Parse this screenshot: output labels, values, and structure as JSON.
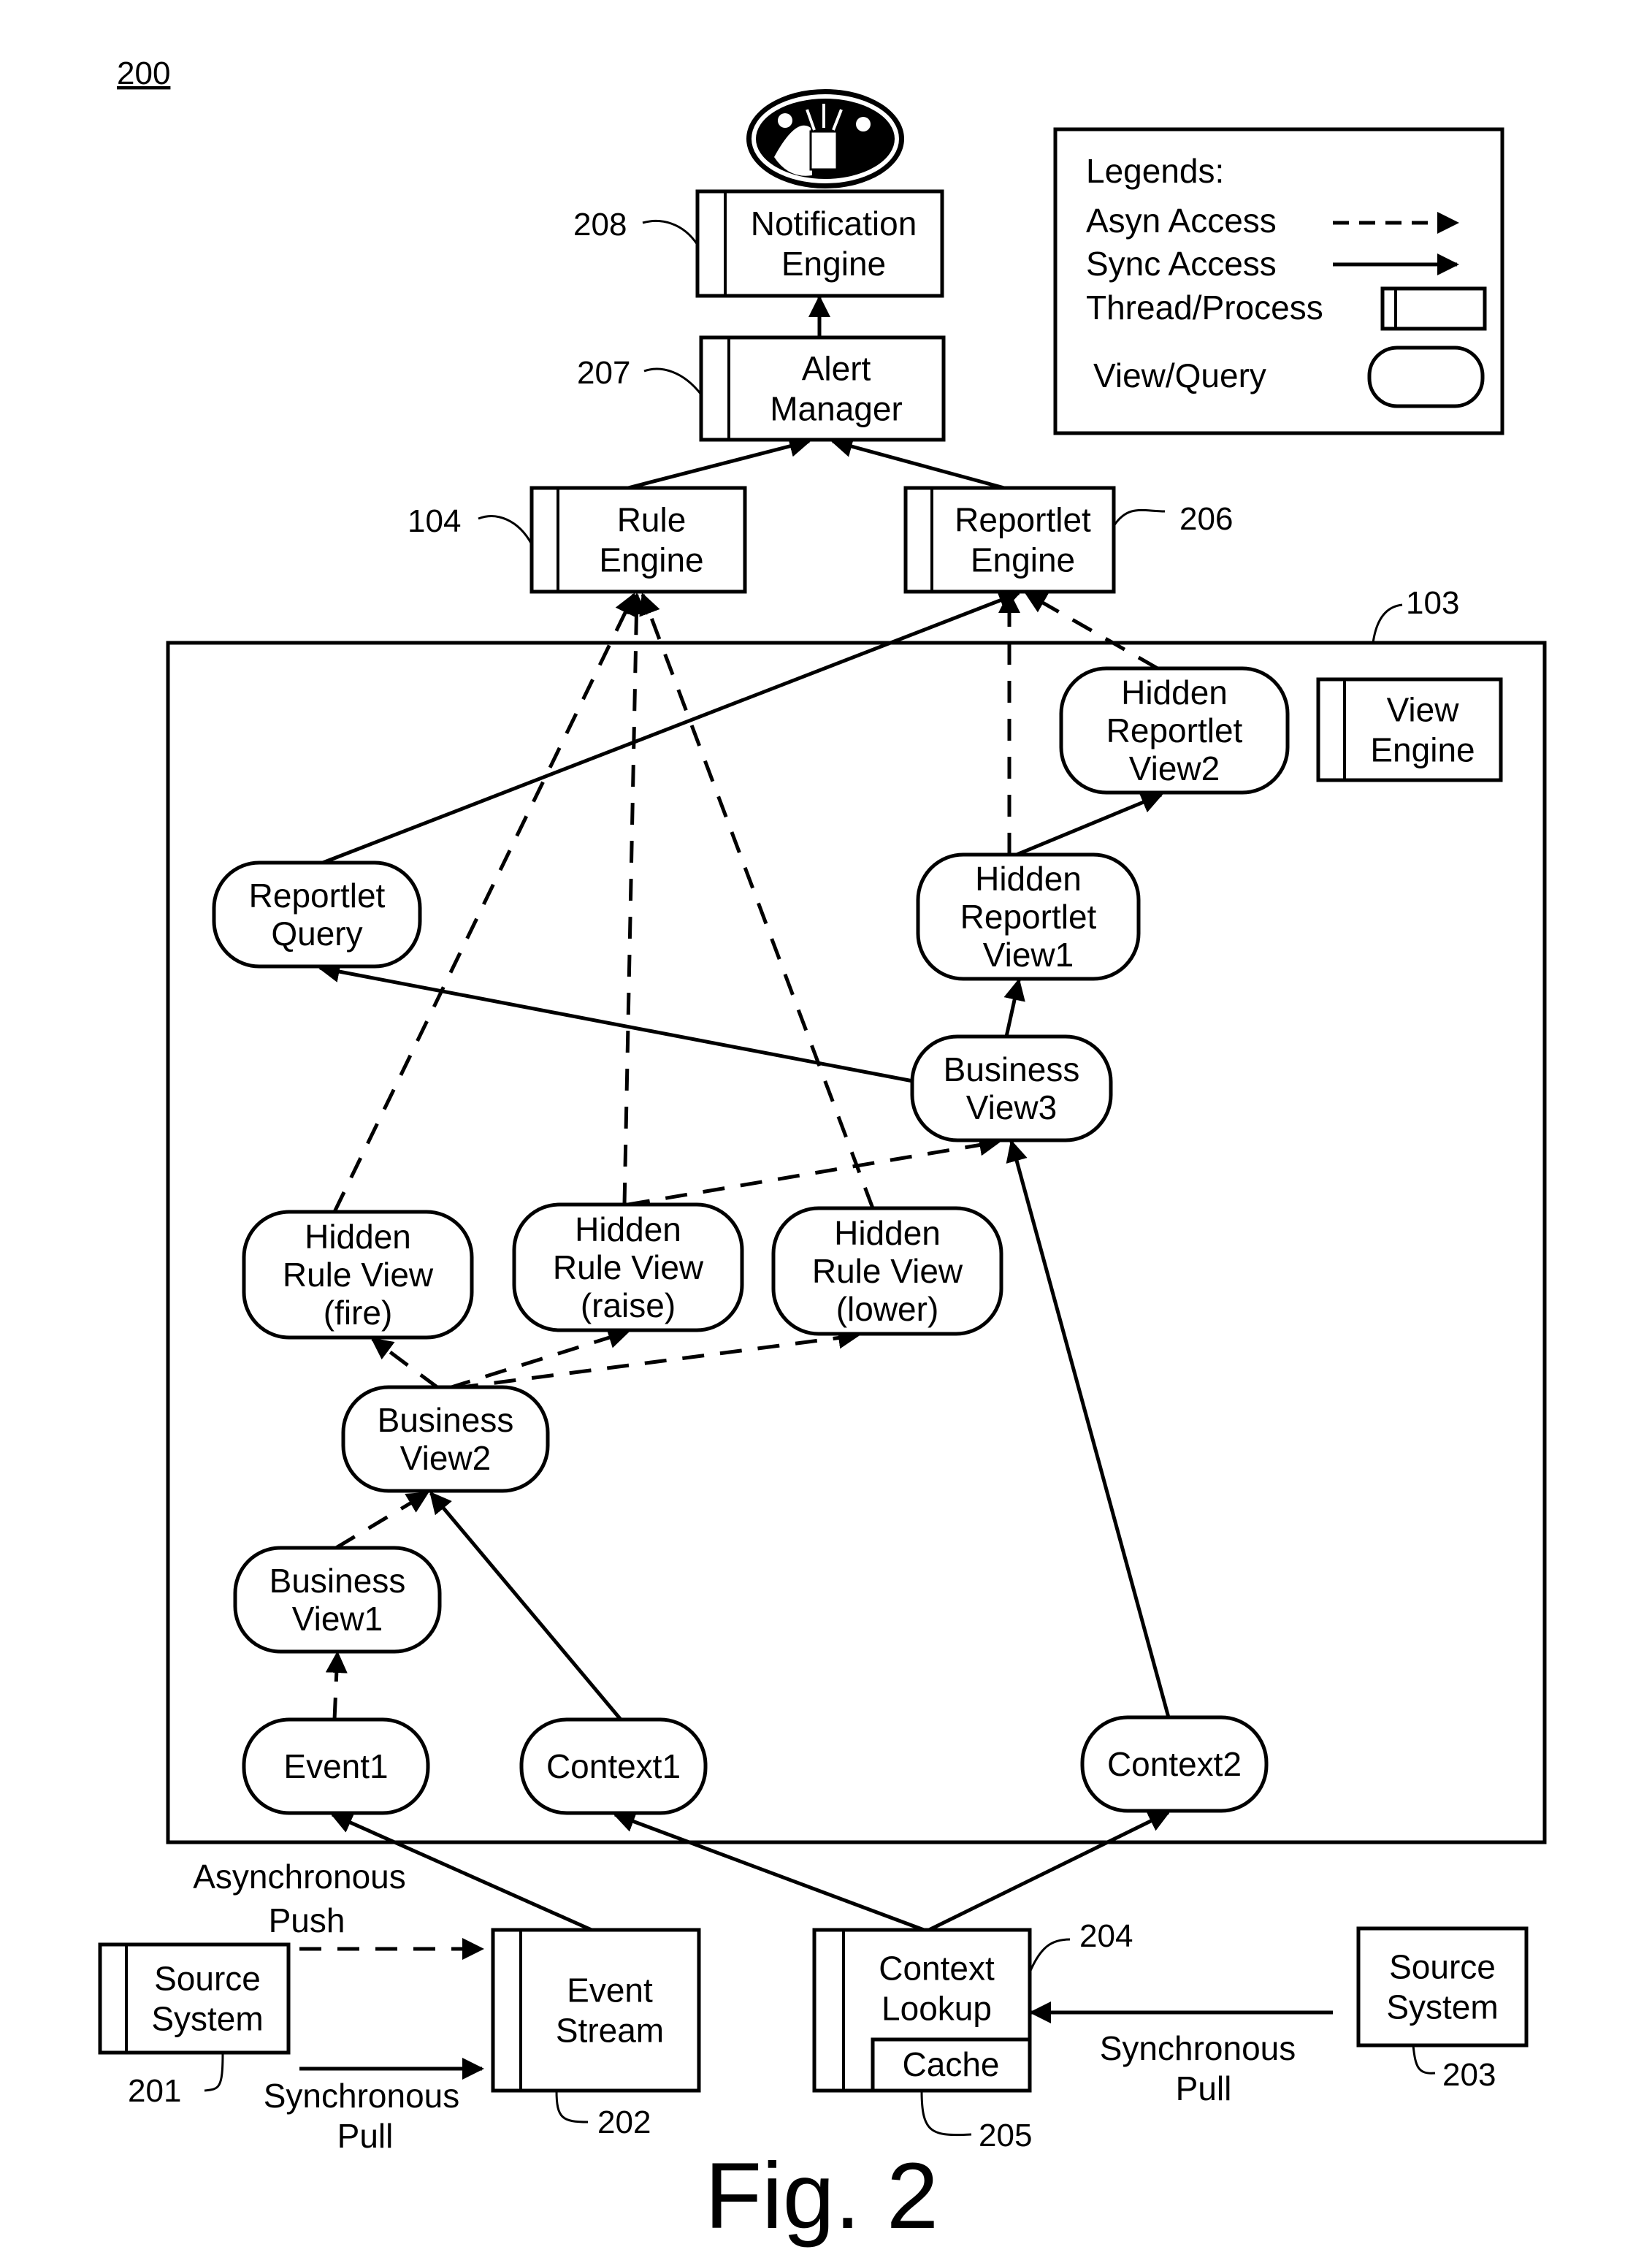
{
  "figure": {
    "id": "200",
    "caption": "Fig. 2"
  },
  "legend": {
    "title": "Legends:",
    "items": [
      {
        "label": "Asyn Access",
        "symbol": "dashed-arrow"
      },
      {
        "label": "Sync Access",
        "symbol": "solid-arrow"
      },
      {
        "label": "Thread/Process",
        "symbol": "thread-box"
      },
      {
        "label": "View/Query",
        "symbol": "rounded-box"
      }
    ]
  },
  "container": {
    "ref": "103"
  },
  "processes": [
    {
      "id": "notification",
      "lines": [
        "Notification",
        "Engine"
      ],
      "ref": "208"
    },
    {
      "id": "alert",
      "lines": [
        "Alert",
        "Manager"
      ],
      "ref": "207"
    },
    {
      "id": "rule",
      "lines": [
        "Rule",
        "Engine"
      ],
      "ref": "104"
    },
    {
      "id": "reportlet",
      "lines": [
        "Reportlet",
        "Engine"
      ],
      "ref": "206"
    },
    {
      "id": "viewengine",
      "lines": [
        "View",
        "Engine"
      ],
      "ref": ""
    },
    {
      "id": "src1",
      "lines": [
        "Source",
        "System"
      ],
      "ref": "201"
    },
    {
      "id": "eventstream",
      "lines": [
        "Event",
        "Stream"
      ],
      "ref": "202"
    },
    {
      "id": "ctxlookup",
      "lines": [
        "Context",
        "Lookup"
      ],
      "ref": "204"
    },
    {
      "id": "src2",
      "lines": [
        "Source",
        "System"
      ],
      "ref": "203"
    }
  ],
  "cache": {
    "label": "Cache",
    "ref": "205"
  },
  "views": [
    {
      "id": "hrv2",
      "lines": [
        "Hidden",
        "Reportlet",
        "View2"
      ]
    },
    {
      "id": "rq",
      "lines": [
        "Reportlet",
        "Query"
      ]
    },
    {
      "id": "hrv1",
      "lines": [
        "Hidden",
        "Reportlet",
        "View1"
      ]
    },
    {
      "id": "bv3",
      "lines": [
        "Business",
        "View3"
      ]
    },
    {
      "id": "fire",
      "lines": [
        "Hidden",
        "Rule View",
        "(fire)"
      ]
    },
    {
      "id": "raise",
      "lines": [
        "Hidden",
        "Rule View",
        "(raise)"
      ]
    },
    {
      "id": "lower",
      "lines": [
        "Hidden",
        "Rule View",
        "(lower)"
      ]
    },
    {
      "id": "bv2",
      "lines": [
        "Business",
        "View2"
      ]
    },
    {
      "id": "bv1",
      "lines": [
        "Business",
        "View1"
      ]
    },
    {
      "id": "event1",
      "lines": [
        "Event1"
      ]
    },
    {
      "id": "context1",
      "lines": [
        "Context1"
      ]
    },
    {
      "id": "context2",
      "lines": [
        "Context2"
      ]
    }
  ],
  "edges": [
    {
      "from": "alert",
      "to": "notification",
      "type": "sync"
    },
    {
      "from": "rule",
      "to": "alert",
      "type": "sync"
    },
    {
      "from": "reportlet",
      "to": "alert",
      "type": "sync"
    },
    {
      "from": "rq",
      "to": "reportlet",
      "type": "sync"
    },
    {
      "from": "hrv1",
      "to": "reportlet",
      "type": "async"
    },
    {
      "from": "hrv2",
      "to": "reportlet",
      "type": "async"
    },
    {
      "from": "hrv1",
      "to": "hrv2",
      "type": "sync"
    },
    {
      "from": "bv3",
      "to": "hrv1",
      "type": "sync"
    },
    {
      "from": "bv3",
      "to": "rq",
      "type": "sync"
    },
    {
      "from": "fire",
      "to": "rule",
      "type": "async"
    },
    {
      "from": "raise",
      "to": "rule",
      "type": "async"
    },
    {
      "from": "lower",
      "to": "rule",
      "type": "async"
    },
    {
      "from": "raise",
      "to": "bv3",
      "type": "async"
    },
    {
      "from": "bv2",
      "to": "fire",
      "type": "async"
    },
    {
      "from": "bv2",
      "to": "raise",
      "type": "async"
    },
    {
      "from": "bv2",
      "to": "lower",
      "type": "async"
    },
    {
      "from": "bv1",
      "to": "bv2",
      "type": "async"
    },
    {
      "from": "context1",
      "to": "bv2",
      "type": "sync"
    },
    {
      "from": "event1",
      "to": "bv1",
      "type": "async"
    },
    {
      "from": "context2",
      "to": "bv3",
      "type": "sync"
    },
    {
      "from": "eventstream",
      "to": "event1",
      "type": "sync"
    },
    {
      "from": "ctxlookup",
      "to": "context1",
      "type": "sync"
    },
    {
      "from": "ctxlookup",
      "to": "context2",
      "type": "sync"
    },
    {
      "from": "src1",
      "to": "eventstream",
      "type": "async",
      "label": [
        "Asynchronous",
        "Push"
      ]
    },
    {
      "from": "src1",
      "to": "eventstream",
      "type": "sync",
      "label": [
        "Synchronous",
        "Pull"
      ]
    },
    {
      "from": "src2",
      "to": "ctxlookup",
      "type": "sync",
      "label": [
        "Synchronous",
        "Pull"
      ]
    }
  ]
}
